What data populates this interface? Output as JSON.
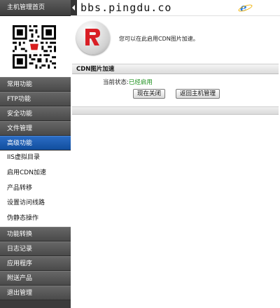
{
  "sidebar": {
    "header": "主机管理首页",
    "menu": [
      {
        "label": "常用功能"
      },
      {
        "label": "FTP功能"
      },
      {
        "label": "安全功能"
      },
      {
        "label": "文件管理"
      },
      {
        "label": "高级功能"
      }
    ],
    "submenu": [
      {
        "label": "IIS虚拟目录"
      },
      {
        "label": "启用CDN加速"
      },
      {
        "label": "产品转移"
      },
      {
        "label": "设置访问线路"
      },
      {
        "label": "伪静态操作"
      }
    ],
    "menu2": [
      {
        "label": "功能转换"
      },
      {
        "label": "日志记录"
      },
      {
        "label": "应用程序"
      },
      {
        "label": "附送产品"
      },
      {
        "label": "退出管理"
      }
    ]
  },
  "topbar": {
    "domain": "bbs.pingdu.co",
    "browser_icon": "e"
  },
  "main": {
    "intro": "您可以在此启用CDN图片加速。",
    "section_title": "CDN图片加速",
    "status_label": "当前状态:",
    "status_value": "已经启用",
    "btn_close": "现在关闭",
    "btn_back": "返回主机管理"
  },
  "colors": {
    "active_menu": "#114e9e",
    "status_ok": "#1a8f1a"
  }
}
